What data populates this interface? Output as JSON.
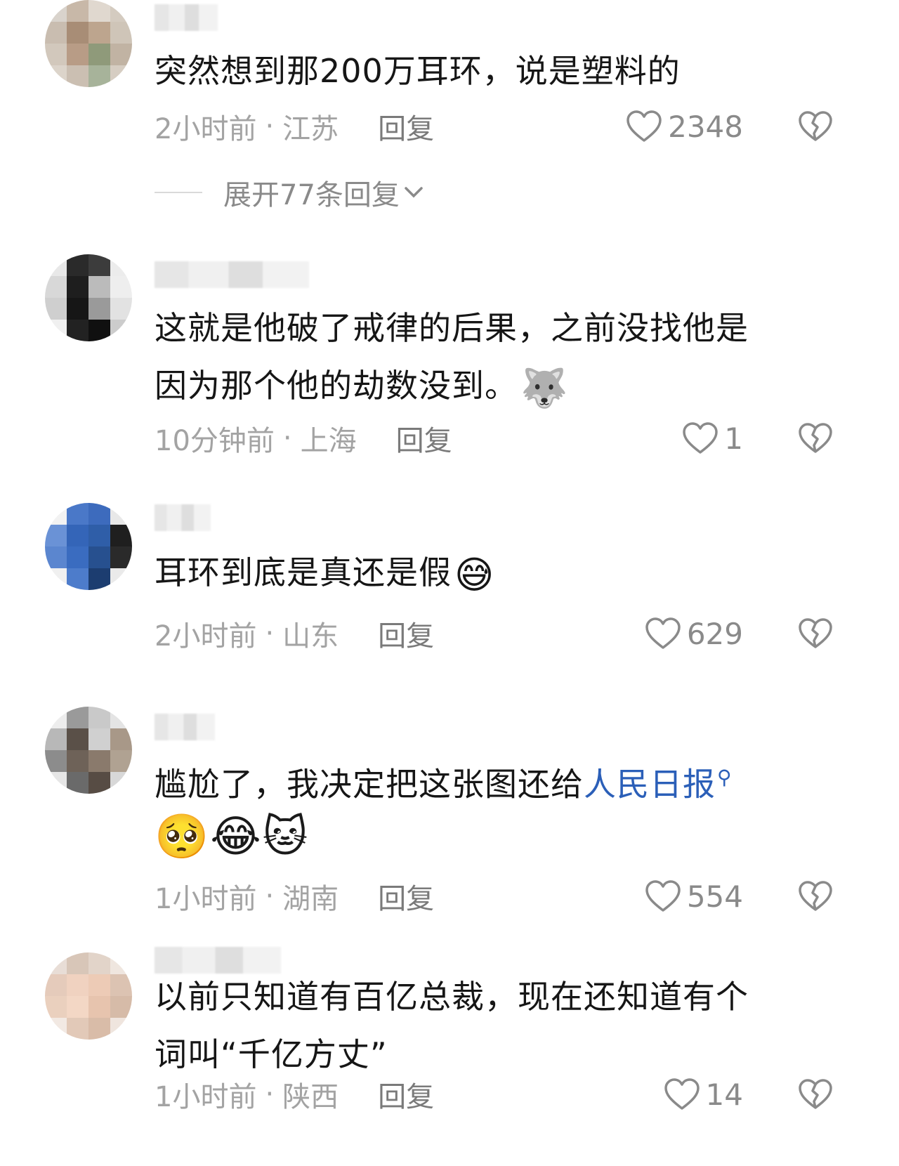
{
  "colors": {
    "text": "#161616",
    "meta": "#a3a3a3",
    "link": "#2b5fb8",
    "icon": "#8a8a8a"
  },
  "comments": [
    {
      "text": "突然想到那200万耳环，说是塑料的",
      "time": "2小时前",
      "location": "江苏",
      "reply_label": "回复",
      "likes": "2348",
      "expand_label": "展开77条回复"
    },
    {
      "text_line1": "这就是他破了戒律的后果，之前没找他是",
      "text_line2": "因为那个他的劫数没到。",
      "emoji": "🐺",
      "time": "10分钟前",
      "location": "上海",
      "reply_label": "回复",
      "likes": "1"
    },
    {
      "text": "耳环到底是真还是假",
      "emoji": "😅",
      "time": "2小时前",
      "location": "山东",
      "reply_label": "回复",
      "likes": "629"
    },
    {
      "text": "尴尬了，我决定把这张图还给",
      "link": "人民日报",
      "emojis": "🥺😂🐱",
      "time": "1小时前",
      "location": "湖南",
      "reply_label": "回复",
      "likes": "554"
    },
    {
      "text_line1": "以前只知道有百亿总裁，现在还知道有个",
      "text_line2": "词叫“千亿方丈”",
      "time": "1小时前",
      "location": "陕西",
      "reply_label": "回复",
      "likes": "14"
    }
  ]
}
